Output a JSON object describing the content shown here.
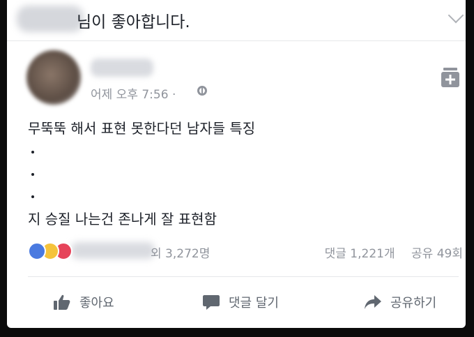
{
  "liked_strip": {
    "text": "님이 좋아합니다."
  },
  "post": {
    "time": "어제 오후 7:56 ·",
    "lines": [
      "무뚝뚝 해서 표현 못한다던 남자들 특징",
      "지 승질 나는건 존나게 잘 표현함"
    ]
  },
  "reactions": {
    "others": "외 3,272명",
    "comments": "댓글 1,221개",
    "shares": "공유 49회"
  },
  "actions": {
    "like": "좋아요",
    "comment": "댓글 달기",
    "share": "공유하기"
  },
  "icons": [
    "chevron-down-icon",
    "globe-icon",
    "save-icon",
    "like-reaction-icon",
    "haha-reaction-icon",
    "love-reaction-icon",
    "thumbs-up-icon",
    "comment-icon",
    "share-icon"
  ],
  "colors": {
    "accent": "#4a7ae0",
    "muted": "#90949c",
    "text": "#1d2129"
  }
}
